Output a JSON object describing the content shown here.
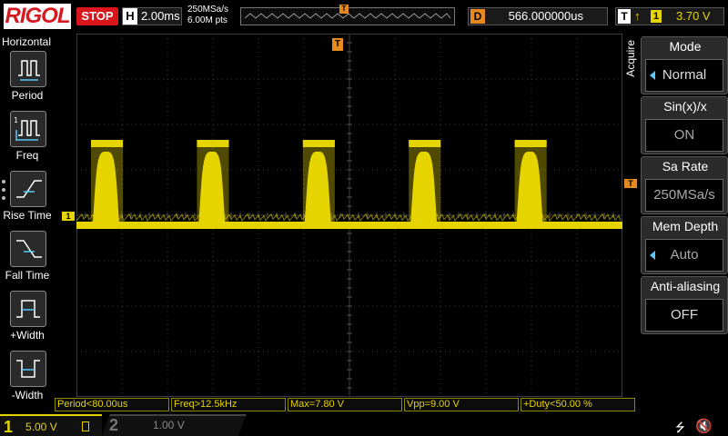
{
  "brand": "RIGOL",
  "run_state": "STOP",
  "horizontal": {
    "letter": "H",
    "timebase": "2.00ms",
    "sample_rate": "250MSa/s",
    "memory_points": "6.00M pts"
  },
  "memory_marker": "T",
  "delay": {
    "letter": "D",
    "value": "566.000000us"
  },
  "trigger": {
    "letter": "T",
    "source": "1",
    "level": "3.70 V"
  },
  "left_menu": {
    "title": "Horizontal",
    "items": [
      {
        "label": "Period",
        "icon": "period-icon"
      },
      {
        "label": "Freq",
        "icon": "freq-icon"
      },
      {
        "label": "Rise Time",
        "icon": "rise-time-icon"
      },
      {
        "label": "Fall Time",
        "icon": "fall-time-icon"
      },
      {
        "label": "+Width",
        "icon": "pos-width-icon"
      },
      {
        "label": "-Width",
        "icon": "neg-width-icon"
      }
    ]
  },
  "markers": {
    "trigger_pos": "T",
    "ch1_ground": "1",
    "trigger_level": "T"
  },
  "right_menu": {
    "side_label": "Acquire",
    "items": [
      {
        "label": "Mode",
        "value": "Normal",
        "has_arrow": true
      },
      {
        "label": "Sin(x)/x",
        "value": "ON",
        "has_arrow": false
      },
      {
        "label": "Sa Rate",
        "value": "250MSa/s",
        "has_arrow": false
      },
      {
        "label": "Mem Depth",
        "value": "Auto",
        "has_arrow": true
      },
      {
        "label": "Anti-aliasing",
        "value": "OFF",
        "has_arrow": false
      }
    ]
  },
  "measurements": [
    "Period<80.00us",
    "Freq>12.5kHz",
    "Max=7.80 V",
    "Vpp=9.00 V",
    "+Duty<50.00 %"
  ],
  "channels": {
    "ch1": {
      "num": "1",
      "scale": "5.00 V"
    },
    "ch2": {
      "num": "2",
      "scale": "1.00 V"
    }
  },
  "colors": {
    "ch1": "#e6d400",
    "trigger": "#e68a1e",
    "stop": "#d9161c",
    "grid": "#3a3a3a"
  },
  "waveform": {
    "pulse_count": 5,
    "low_level_div": -0.2,
    "high_level_div": 1.6
  }
}
